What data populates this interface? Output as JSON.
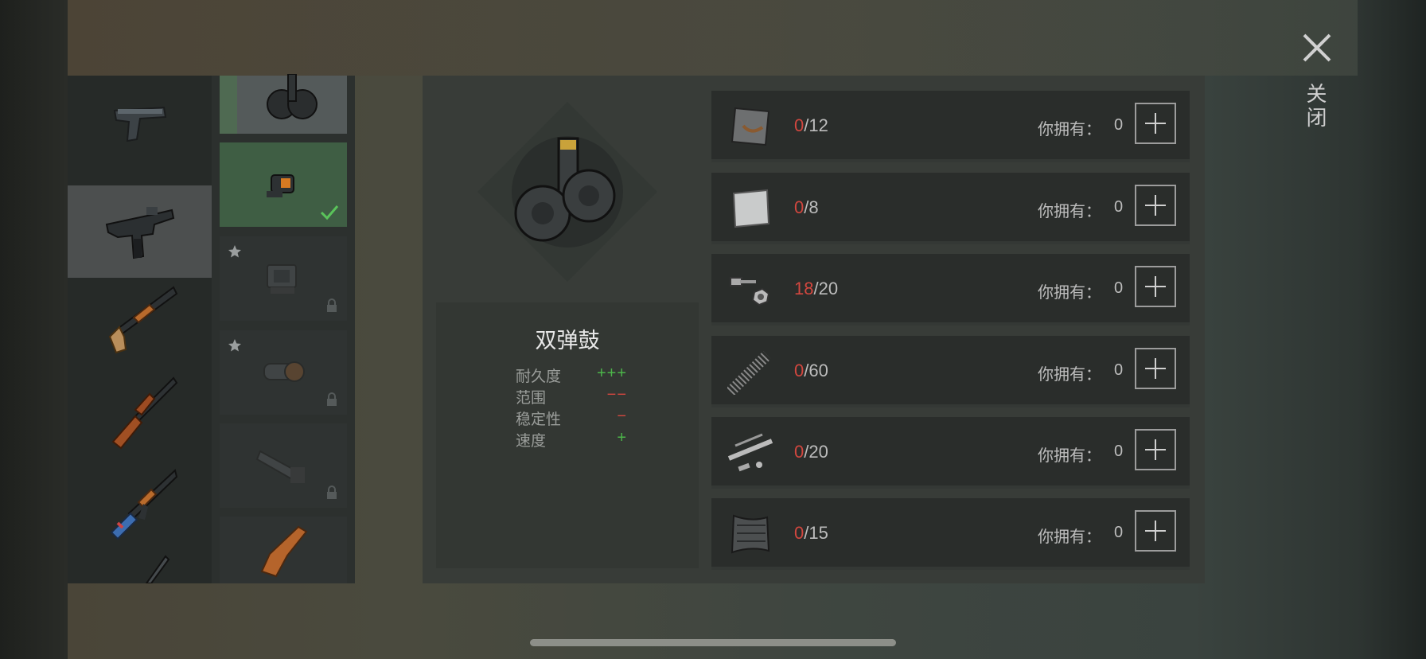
{
  "weapons": [
    {
      "name": "pistol-icon",
      "selected": false
    },
    {
      "name": "smg-uzi-icon",
      "selected": true
    },
    {
      "name": "shotgun-icon",
      "selected": false
    },
    {
      "name": "lever-rifle-icon",
      "selected": false
    },
    {
      "name": "ak-rifle-icon",
      "selected": false
    },
    {
      "name": "sniper-rifle-icon",
      "selected": false
    }
  ],
  "attachments": [
    {
      "name": "drum-magazine-icon",
      "state": "selected"
    },
    {
      "name": "red-dot-sight-icon",
      "state": "equipped"
    },
    {
      "name": "holo-sight-icon",
      "state": "locked",
      "starred": true
    },
    {
      "name": "scope-sight-icon",
      "state": "locked",
      "starred": true
    },
    {
      "name": "long-scope-icon",
      "state": "locked",
      "starred": false
    },
    {
      "name": "wooden-stock-icon",
      "state": "available",
      "starred": false
    }
  ],
  "item": {
    "name": "双弹鼓",
    "stats": [
      {
        "label": "耐久度",
        "value": "+++",
        "kind": "positive"
      },
      {
        "label": "范围",
        "value": "−−",
        "kind": "negative"
      },
      {
        "label": "稳定性",
        "value": "−",
        "kind": "negative"
      },
      {
        "label": "速度",
        "value": "+",
        "kind": "positive"
      }
    ]
  },
  "materials": [
    {
      "icon": "metal-plate-icon",
      "have": "0",
      "need": "/12",
      "owned_label": "你拥有：",
      "owned": "0"
    },
    {
      "icon": "steel-sheet-icon",
      "have": "0",
      "need": "/8",
      "owned_label": "你拥有：",
      "owned": "0"
    },
    {
      "icon": "bolts-nuts-icon",
      "have": "18",
      "need": "/20",
      "owned_label": "你拥有：",
      "owned": "0"
    },
    {
      "icon": "spring-icon",
      "have": "0",
      "need": "/60",
      "owned_label": "你拥有：",
      "owned": "0"
    },
    {
      "icon": "gun-parts-icon",
      "have": "0",
      "need": "/20",
      "owned_label": "你拥有：",
      "owned": "0"
    },
    {
      "icon": "carbon-sheet-icon",
      "have": "0",
      "need": "/15",
      "owned_label": "你拥有：",
      "owned": "0"
    }
  ],
  "close_label": "关闭",
  "colors": {
    "negative": "#d2473f",
    "positive": "#4cb54a",
    "equipped": "#3f5e44"
  }
}
